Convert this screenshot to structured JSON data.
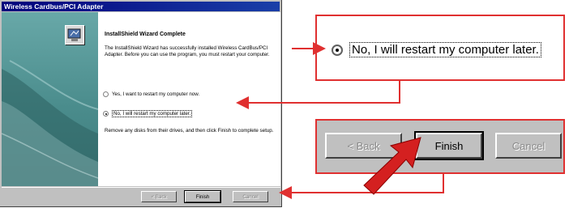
{
  "window": {
    "title": "Wireless Cardbus/PCI Adapter",
    "heading": "InstallShield Wizard Complete",
    "message": "The InstallShield Wizard has successfully installed Wireless CardBus/PCI Adapter.  Before you can use the program, you must restart your computer.",
    "options": [
      {
        "label": "Yes, I want to restart my computer now.",
        "selected": false
      },
      {
        "label": "No, I will restart my computer later.",
        "selected": true
      }
    ],
    "instruction": "Remove any disks from their drives, and then click Finish to complete setup.",
    "buttons": {
      "back": "< Back",
      "finish": "Finish",
      "cancel": "Cancel"
    }
  },
  "zoom_radio": {
    "label": "No, I will restart my computer later."
  },
  "zoom_buttons": {
    "back": "< Back",
    "finish": "Finish",
    "cancel": "Cancel"
  },
  "colors": {
    "callout_border": "#e03030",
    "arrow": "#e03030",
    "titlebar": "#00007b",
    "sidebar_teal": "#4a8c8c"
  }
}
